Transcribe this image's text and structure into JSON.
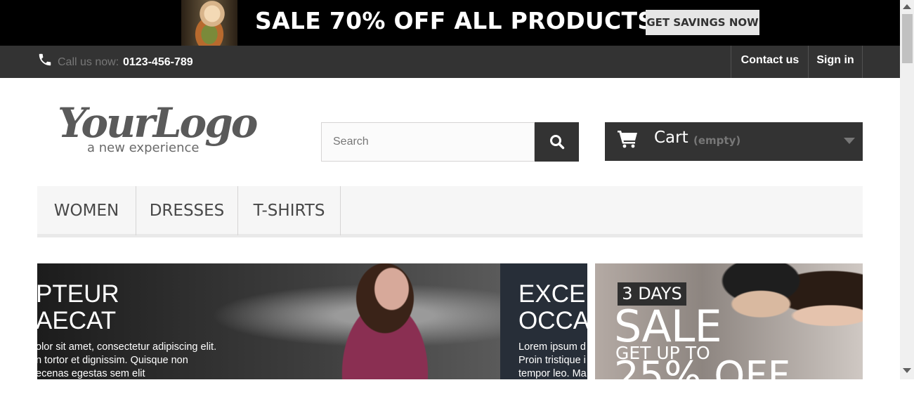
{
  "banner": {
    "text": "SALE 70% OFF ALL PRODUCTS",
    "button": "GET SAVINGS NOW"
  },
  "nav": {
    "call_label": "Call us now:",
    "phone": "0123-456-789",
    "links": [
      "Contact us",
      "Sign in"
    ]
  },
  "logo": {
    "wordmark": "YourLogo",
    "tagline": "a new experience"
  },
  "search": {
    "placeholder": "Search"
  },
  "cart": {
    "label": "Cart",
    "status": "(empty)"
  },
  "menu": [
    "WOMEN",
    "DRESSES",
    "T-SHIRTS"
  ],
  "slider": {
    "slide1": {
      "title": [
        "PTEUR",
        "AECAT"
      ],
      "text": [
        "olor sit amet, consectetur adipiscing elit.",
        "n tortor et dignissim. Quisque non",
        "ecenas egestas sem elit"
      ]
    },
    "slide2": {
      "title": [
        "EXCE",
        "OCCA"
      ],
      "text": [
        "Lorem ipsum d",
        "Proin tristique i",
        "tempor leo. Ma"
      ]
    }
  },
  "promo": {
    "days": "3 DAYS",
    "sale": "SALE",
    "get_up_to": "GET UP TO",
    "percent": "25% OFF"
  },
  "icons": [
    "phone-icon",
    "search-icon",
    "cart-icon",
    "caret-down-icon"
  ],
  "colors": {
    "dark": "#333333",
    "banner": "#000000",
    "menu_bg": "#f6f6f6"
  }
}
